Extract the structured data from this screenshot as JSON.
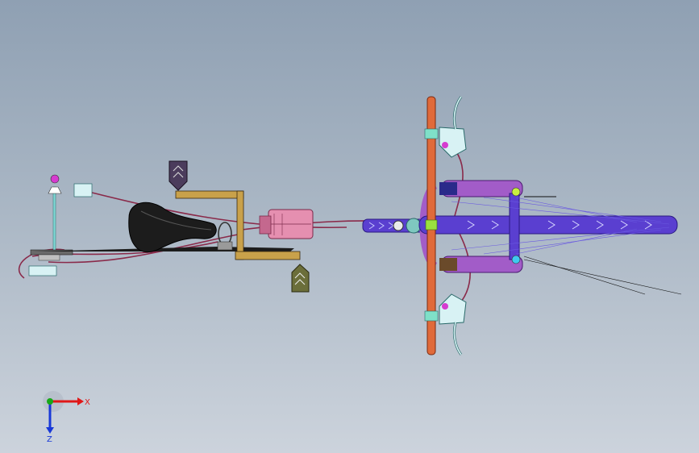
{
  "viewport": {
    "background_top": "#8fa0b3",
    "background_bottom": "#ccd3dc"
  },
  "colors": {
    "frame": "#5a3fd0",
    "frame_dark": "#3b24a8",
    "handlebar": "#e06a3a",
    "fork": "#a25cc8",
    "seat": "#1c1c1c",
    "seat_rail": "#c9a14a",
    "motor": "#e58fb0",
    "brake_lever": "#d8f2f4",
    "pedal": "#4b3c5c",
    "pedal_right": "#6b6e3a",
    "cable": "#8a2a4a",
    "spoke": "#6a5ae0",
    "axis_x": "#e01818",
    "axis_y": "#18a818",
    "axis_z": "#1838d8"
  },
  "triad": {
    "x_label": "X",
    "z_label": "Z"
  },
  "icons": {
    "triad": "coordinate-triad-icon"
  }
}
